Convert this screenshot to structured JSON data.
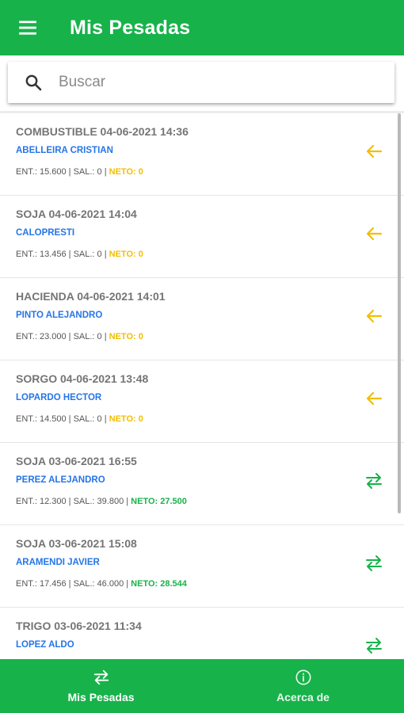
{
  "appbar": {
    "title": "Mis Pesadas",
    "menu_icon": "hamburger-menu-icon"
  },
  "search": {
    "placeholder": "Buscar",
    "value": ""
  },
  "colors": {
    "primary": "#17b24a",
    "link_blue": "#2575e8",
    "pending_yellow": "#f2be00"
  },
  "items": [
    {
      "title": "COMBUSTIBLE 04-06-2021 14:36",
      "name": "ABELLEIRA CRISTIAN",
      "ent": "ENT.: 15.600",
      "sal": "SAL.: 0",
      "neto": "NETO: 0",
      "status": "pending",
      "icon": "arrow-left-icon"
    },
    {
      "title": "SOJA 04-06-2021 14:04",
      "name": "CALOPRESTI",
      "ent": "ENT.: 13.456",
      "sal": "SAL.: 0",
      "neto": "NETO: 0",
      "status": "pending",
      "icon": "arrow-left-icon"
    },
    {
      "title": "HACIENDA 04-06-2021 14:01",
      "name": "PINTO ALEJANDRO",
      "ent": "ENT.: 23.000",
      "sal": "SAL.: 0",
      "neto": "NETO: 0",
      "status": "pending",
      "icon": "arrow-left-icon"
    },
    {
      "title": "SORGO 04-06-2021 13:48",
      "name": "LOPARDO HECTOR",
      "ent": "ENT.: 14.500",
      "sal": "SAL.: 0",
      "neto": "NETO: 0",
      "status": "pending",
      "icon": "arrow-left-icon"
    },
    {
      "title": "SOJA 03-06-2021 16:55",
      "name": "PEREZ ALEJANDRO",
      "ent": "ENT.: 12.300",
      "sal": "SAL.: 39.800",
      "neto": "NETO: 27.500",
      "status": "complete",
      "icon": "swap-arrows-icon"
    },
    {
      "title": "SOJA 03-06-2021 15:08",
      "name": "ARAMENDI JAVIER",
      "ent": "ENT.: 17.456",
      "sal": "SAL.: 46.000",
      "neto": "NETO: 28.544",
      "status": "complete",
      "icon": "swap-arrows-icon"
    },
    {
      "title": "TRIGO 03-06-2021 11:34",
      "name": "LOPEZ ALDO",
      "ent": "",
      "sal": "",
      "neto": "",
      "status": "complete",
      "icon": "swap-arrows-icon"
    }
  ],
  "bottom_nav": {
    "tabs": [
      {
        "label": "Mis Pesadas",
        "icon": "swap-arrows-icon",
        "active": true
      },
      {
        "label": "Acerca de",
        "icon": "info-icon",
        "active": false
      }
    ]
  }
}
